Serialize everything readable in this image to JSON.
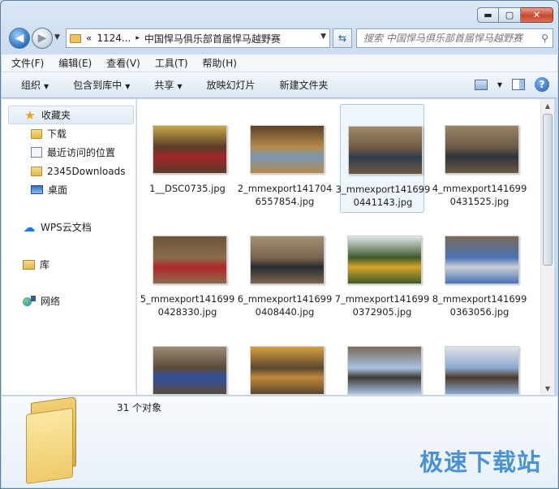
{
  "window": {
    "caption_buttons": {
      "minimize": "▬",
      "maximize": "▢",
      "close": "✕"
    }
  },
  "address": {
    "prefix": "«",
    "segments": [
      "1124...",
      "中国悍马俱乐部首届悍马越野赛"
    ],
    "separator": "▸",
    "search_placeholder": "搜索 中国悍马俱乐部首届悍马越野赛"
  },
  "menu": [
    "文件(F)",
    "编辑(E)",
    "查看(V)",
    "工具(T)",
    "帮助(H)"
  ],
  "toolbar": {
    "organize": "组织",
    "include_library": "包含到库中",
    "share": "共享",
    "slideshow": "放映幻灯片",
    "new_folder": "新建文件夹",
    "caret": "▼",
    "help": "?"
  },
  "nav": {
    "favorites": {
      "label": "收藏夹",
      "items": [
        "下载",
        "最近访问的位置",
        "2345Downloads",
        "桌面"
      ]
    },
    "wps": "WPS云文档",
    "library": "库",
    "network": "网络"
  },
  "files": [
    {
      "name": "1__DSC0735.jpg",
      "colors": [
        "#5b3b2a",
        "#a2262a",
        "#c9a84a"
      ]
    },
    {
      "name": "2_mmexport1417046557854.jpg",
      "colors": [
        "#b78a4b",
        "#7a97b5",
        "#5a4226"
      ]
    },
    {
      "name": "3_mmexport1416990441143.jpg",
      "colors": [
        "#6e5a44",
        "#2f3b4d",
        "#a08969"
      ]
    },
    {
      "name": "4_mmexport1416990431525.jpg",
      "colors": [
        "#6b5a45",
        "#30323a",
        "#9a8467"
      ]
    },
    {
      "name": "5_mmexport1416990428330.jpg",
      "colors": [
        "#8a6c4d",
        "#b0262a",
        "#6b5538"
      ]
    },
    {
      "name": "6_mmexport1416990408440.jpg",
      "colors": [
        "#7a6650",
        "#2a2c30",
        "#a48e72"
      ]
    },
    {
      "name": "7_mmexport1416990372905.jpg",
      "colors": [
        "#3c5a2a",
        "#d9a32b",
        "#e3e6ea"
      ]
    },
    {
      "name": "8_mmexport1416990363056.jpg",
      "colors": [
        "#4b72b6",
        "#c8cfd6",
        "#7a6a58"
      ]
    },
    {
      "name": "",
      "colors": [
        "#5a4a3a",
        "#2f4fa0",
        "#9a8a72"
      ]
    },
    {
      "name": "",
      "colors": [
        "#5c4630",
        "#c08a3a",
        "#d6a13e"
      ]
    },
    {
      "name": "",
      "colors": [
        "#a9c3e0",
        "#3f3a35",
        "#7a6a5a"
      ]
    },
    {
      "name": "",
      "colors": [
        "#8aa8cf",
        "#4d3a2a",
        "#dfe4ea"
      ]
    }
  ],
  "status": {
    "count": "31 个对象"
  },
  "watermark": "极速下载站",
  "accent": "#4a92d4"
}
